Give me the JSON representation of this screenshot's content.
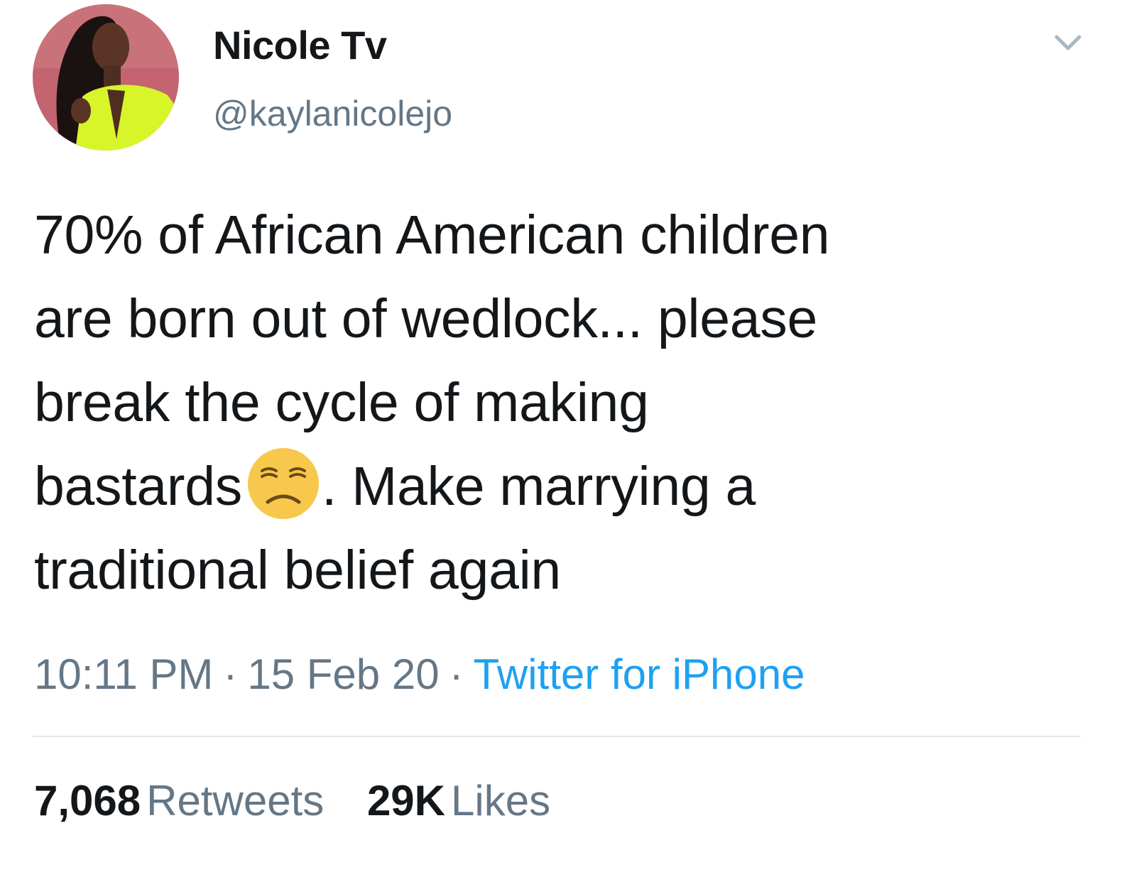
{
  "author": {
    "display_name": "Nicole Tv",
    "handle": "@kaylanicolejo",
    "avatar_icon": "profile-photo-avatar"
  },
  "header": {
    "menu_icon": "chevron-down-icon"
  },
  "tweet": {
    "lines": [
      "70% of African American children",
      "are born out of wedlock... please",
      "break the cycle of making",
      "bastards",
      ". Make marrying a",
      "traditional belief again"
    ],
    "emoji": "unamused-face-emoji"
  },
  "meta": {
    "time": "10:11 PM",
    "separator": "·",
    "date": "15 Feb 20",
    "source": "Twitter for iPhone"
  },
  "stats": {
    "retweets_count": "7,068",
    "retweets_label": "Retweets",
    "likes_count": "29K",
    "likes_label": "Likes"
  },
  "colors": {
    "text": "#14171a",
    "secondary": "#657786",
    "link": "#1da1f2",
    "divider": "#e1e8ed",
    "emoji_yellow": "#f7c84b"
  }
}
